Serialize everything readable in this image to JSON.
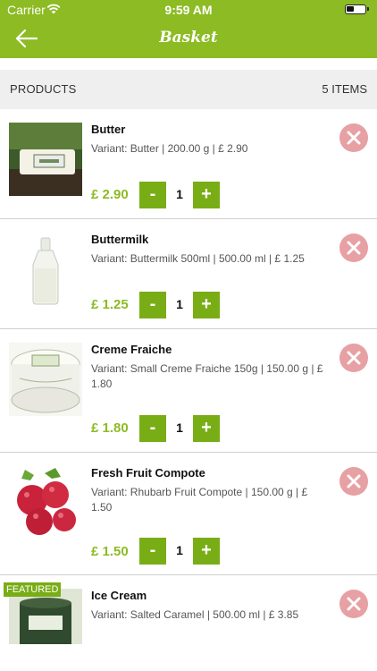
{
  "status_bar": {
    "carrier": "Carrier",
    "time": "9:59 AM"
  },
  "nav": {
    "title": "Basket",
    "back_icon": "arrow-left-icon"
  },
  "section": {
    "left_label": "PRODUCTS",
    "right_label": "5 ITEMS"
  },
  "colors": {
    "accent": "#8cbb23",
    "stepper": "#79ad16",
    "remove": "#e7a0a3"
  },
  "items": [
    {
      "name": "Butter",
      "variant": "Variant: Butter | 200.00 g  |  £ 2.90",
      "price": "£ 2.90",
      "minus": "-",
      "qty": "1",
      "plus": "+"
    },
    {
      "name": "Buttermilk",
      "variant": "Variant: Buttermilk 500ml | 500.00 ml  |  £ 1.25",
      "price": "£ 1.25",
      "minus": "-",
      "qty": "1",
      "plus": "+"
    },
    {
      "name": "Creme Fraiche",
      "variant": "Variant: Small Creme Fraiche 150g | 150.00 g  |  £ 1.80",
      "price": "£ 1.80",
      "minus": "-",
      "qty": "1",
      "plus": "+"
    },
    {
      "name": "Fresh Fruit Compote",
      "variant": "Variant: Rhubarb Fruit Compote | 150.00 g  |  £ 1.50",
      "price": "£ 1.50",
      "minus": "-",
      "qty": "1",
      "plus": "+"
    },
    {
      "name": "Ice Cream",
      "variant": "Variant: Salted Caramel | 500.00 ml  |  £ 3.85",
      "badge": "FEATURED"
    }
  ]
}
